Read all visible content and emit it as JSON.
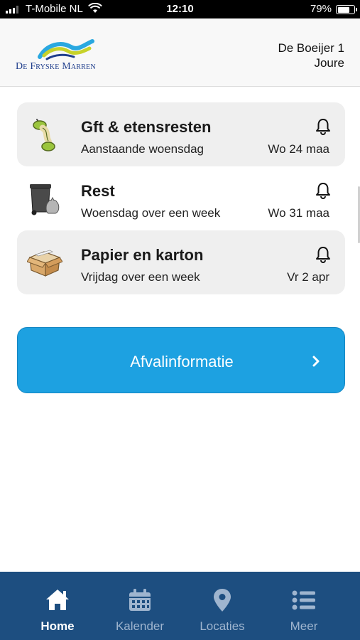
{
  "status_bar": {
    "carrier": "T-Mobile NL",
    "time": "12:10",
    "battery": "79%",
    "battery_level": 0.79
  },
  "header": {
    "logo_text": "De Fryske Marren",
    "address_line1": "De Boeijer 1",
    "address_line2": "Joure"
  },
  "collections": [
    {
      "title": "Gft & etensresten",
      "subtitle": "Aanstaande woensdag",
      "date": "Wo 24 maa",
      "icon": "apple-core-icon"
    },
    {
      "title": "Rest",
      "subtitle": "Woensdag over een week",
      "date": "Wo 31 maa",
      "icon": "waste-bin-icon"
    },
    {
      "title": "Papier en karton",
      "subtitle": "Vrijdag over een week",
      "date": "Vr 2 apr",
      "icon": "cardboard-box-icon"
    }
  ],
  "info_button": {
    "label": "Afvalinformatie"
  },
  "tabs": [
    {
      "label": "Home",
      "icon": "home-icon",
      "active": true
    },
    {
      "label": "Kalender",
      "icon": "calendar-icon",
      "active": false
    },
    {
      "label": "Locaties",
      "icon": "location-pin-icon",
      "active": false
    },
    {
      "label": "Meer",
      "icon": "list-icon",
      "active": false
    }
  ],
  "colors": {
    "accent": "#1da1e1",
    "tabbar": "#1d4e80",
    "card": "#efefef"
  }
}
